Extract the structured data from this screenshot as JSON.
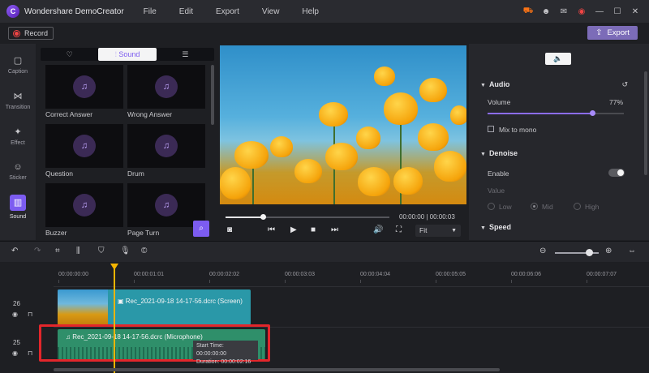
{
  "app": {
    "title": "Wondershare DemoCreator",
    "menu": [
      "File",
      "Edit",
      "Export",
      "View",
      "Help"
    ]
  },
  "toolbar": {
    "record_label": "Record",
    "export_label": "Export"
  },
  "rail": [
    {
      "label": "Caption",
      "icon": "caption-icon",
      "glyph": "▢"
    },
    {
      "label": "Transition",
      "icon": "transition-icon",
      "glyph": "⋈"
    },
    {
      "label": "Effect",
      "icon": "effect-icon",
      "glyph": "✦"
    },
    {
      "label": "Sticker",
      "icon": "sticker-icon",
      "glyph": "☺"
    },
    {
      "label": "Sound",
      "icon": "sound-icon",
      "glyph": "▥"
    }
  ],
  "library": {
    "tabs": [
      "♡",
      "Sound",
      "☰"
    ],
    "items": [
      "Correct Answer",
      "Wrong Answer",
      "Question",
      "Drum",
      "Buzzer",
      "Page Turn"
    ]
  },
  "preview": {
    "timecode": "00:00:00 | 00:00:03",
    "fit_value": "Fit",
    "progress_fraction": 0.0
  },
  "properties": {
    "audio_section": "Audio",
    "volume_label": "Volume",
    "volume_value": "77%",
    "volume_fraction": 0.77,
    "mix_label": "Mix to mono",
    "denoise_section": "Denoise",
    "enable_label": "Enable",
    "value_label": "Value",
    "levels": [
      "Low",
      "Mid",
      "High"
    ],
    "selected_level": "Mid",
    "speed_section": "Speed"
  },
  "timeline": {
    "ticks": [
      "00:00:00:00",
      "00:00:01:01",
      "00:00:02:02",
      "00:00:03:03",
      "00:00:04:04",
      "00:00:05:05",
      "00:00:06:06",
      "00:00:07:07"
    ],
    "tracks": [
      {
        "number": "26",
        "clip": "Rec_2021-09-18 14-17-56.dcrc (Screen)"
      },
      {
        "number": "25",
        "clip": "Rec_2021-09-18 14-17-56.dcrc (Microphone)"
      }
    ],
    "tooltip": {
      "start": "Start Time: 00:00:00:00",
      "duration": "Duration: 00:00:02:16"
    }
  },
  "colors": {
    "accent": "#7c5cf0",
    "highlight": "#e3262b",
    "playhead": "#f4b400"
  }
}
